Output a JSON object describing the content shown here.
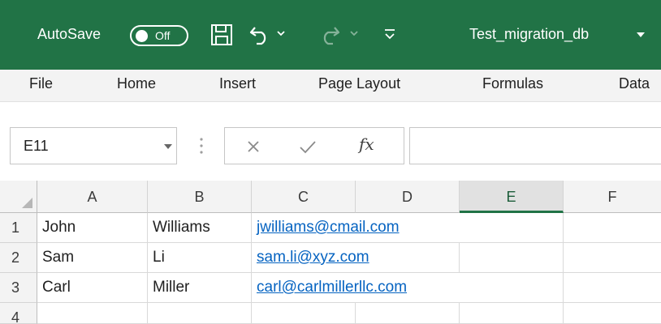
{
  "titlebar": {
    "autosave_label": "AutoSave",
    "toggle_state": "Off",
    "doc_title": "Test_migration_db",
    "icons": [
      "save-icon",
      "undo-icon",
      "redo-icon",
      "customize-qat-icon",
      "chevron-down-icon"
    ],
    "background": "#217346"
  },
  "ribbon": {
    "tabs": [
      {
        "label": "File"
      },
      {
        "label": "Home"
      },
      {
        "label": "Insert"
      },
      {
        "label": "Page Layout"
      },
      {
        "label": "Formulas"
      },
      {
        "label": "Data"
      }
    ]
  },
  "formula_bar": {
    "name_box": "E11",
    "formula_value": "",
    "icons": [
      "cancel-icon",
      "enter-icon",
      "insert-function-icon"
    ]
  },
  "grid": {
    "columns": [
      "A",
      "B",
      "C",
      "D",
      "E",
      "F"
    ],
    "selected_column": "E",
    "rows": [
      {
        "num": "1",
        "A": "John",
        "B": "Williams",
        "C": "jwilliams@cmail.com"
      },
      {
        "num": "2",
        "A": "Sam",
        "B": "Li",
        "C": "sam.li@xyz.com"
      },
      {
        "num": "3",
        "A": "Carl",
        "B": "Miller",
        "C": "carl@carlmillerllc.com"
      },
      {
        "num": "4",
        "A": "",
        "B": "",
        "C": ""
      }
    ],
    "link_color": "#0563c1"
  }
}
